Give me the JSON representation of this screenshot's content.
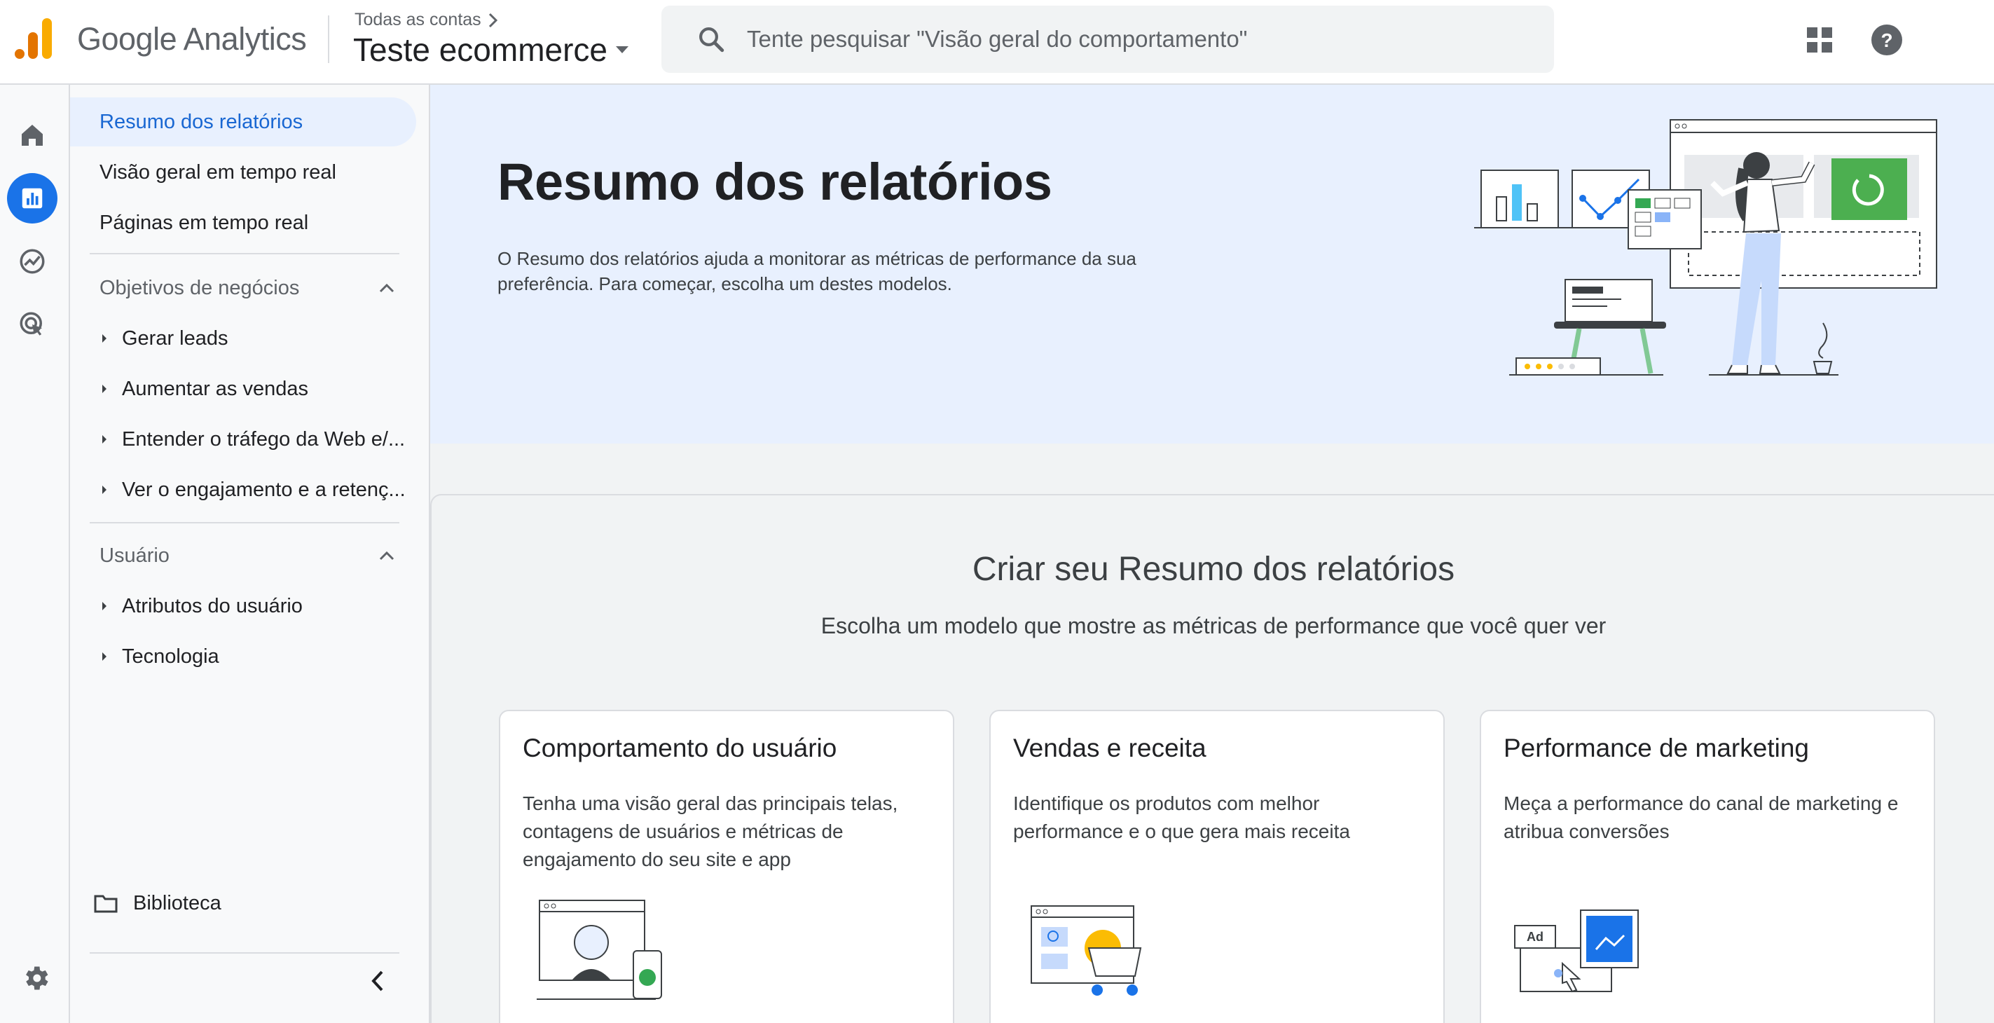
{
  "header": {
    "brand": "Google Analytics",
    "account_crumb": "Todas as contas",
    "property_name": "Teste ecommerce",
    "search_placeholder": "Tente pesquisar \"Visão geral do comportamento\""
  },
  "rail": {
    "items": [
      "home-icon",
      "reports-icon",
      "explore-icon",
      "advertising-icon"
    ],
    "active": "reports-icon"
  },
  "sidenav": {
    "items": [
      {
        "label": "Resumo dos relatórios",
        "active": true
      },
      {
        "label": "Visão geral em tempo real"
      },
      {
        "label": "Páginas em tempo real"
      }
    ],
    "sections": [
      {
        "label": "Objetivos de negócios",
        "children": [
          "Gerar leads",
          "Aumentar as vendas",
          "Entender o tráfego da Web e/...",
          "Ver o engajamento e a retenç..."
        ]
      },
      {
        "label": "Usuário",
        "children": [
          "Atributos do usuário",
          "Tecnologia"
        ]
      }
    ],
    "library": "Biblioteca"
  },
  "hero": {
    "title": "Resumo dos relatórios",
    "description": "O Resumo dos relatórios ajuda a monitorar as métricas de performance da sua preferência. Para começar, escolha um destes modelos."
  },
  "templates": {
    "title": "Criar seu Resumo dos relatórios",
    "subtitle": "Escolha um modelo que mostre as métricas de performance que você quer ver",
    "cards": [
      {
        "title": "Comportamento do usuário",
        "description": "Tenha uma visão geral das principais telas, contagens de usuários e métricas de engajamento do seu site e app"
      },
      {
        "title": "Vendas e receita",
        "description": "Identifique os produtos com melhor performance e o que gera mais receita"
      },
      {
        "title": "Performance de marketing",
        "description": "Meça a performance do canal de marketing e atribua conversões",
        "ad_badge": "Ad"
      }
    ]
  },
  "colors": {
    "accent": "#1a73e8",
    "active_bg": "#e8f0fe",
    "ga_orange": "#f9ab00",
    "ga_dark_orange": "#e37400",
    "green": "#34a853"
  }
}
